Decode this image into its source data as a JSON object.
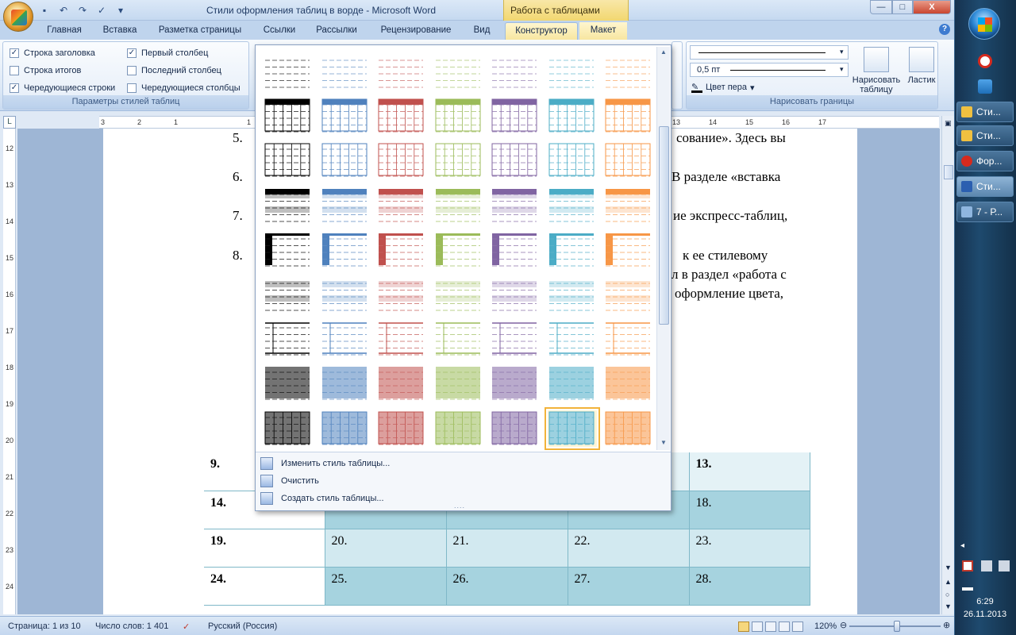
{
  "window": {
    "title": "Стили оформления таблиц в ворде - Microsoft Word",
    "context_tab_title": "Работа с таблицами",
    "controls": {
      "minimize": "—",
      "maximize": "□",
      "close": "X"
    }
  },
  "tabs": [
    {
      "label": "Главная"
    },
    {
      "label": "Вставка"
    },
    {
      "label": "Разметка страницы"
    },
    {
      "label": "Ссылки"
    },
    {
      "label": "Рассылки"
    },
    {
      "label": "Рецензирование"
    },
    {
      "label": "Вид"
    },
    {
      "label": "Конструктор",
      "active": true
    },
    {
      "label": "Макет"
    }
  ],
  "ribbon": {
    "style_options": {
      "group_label": "Параметры стилей таблиц",
      "options": [
        {
          "label": "Строка заголовка",
          "checked": true,
          "mark": "✓"
        },
        {
          "label": "Строка итогов",
          "checked": false,
          "mark": ""
        },
        {
          "label": "Чередующиеся строки",
          "checked": true,
          "mark": "✓"
        },
        {
          "label": "Первый столбец",
          "checked": true,
          "mark": "✓"
        },
        {
          "label": "Последний столбец",
          "checked": false,
          "mark": ""
        },
        {
          "label": "Чередующиеся столбцы",
          "checked": false,
          "mark": ""
        }
      ]
    },
    "draw_borders": {
      "group_label": "Нарисовать границы",
      "pen_weight": "0,5 пт",
      "pen_color_label": "Цвет пера",
      "draw_table_label": "Нарисовать таблицу",
      "eraser_label": "Ластик"
    }
  },
  "gallery": {
    "palette": [
      "#000000",
      "#4f81bd",
      "#c0504d",
      "#9bbb59",
      "#8064a2",
      "#4bacc6",
      "#f79646"
    ],
    "selected": {
      "row": 8,
      "col": 5
    },
    "menu": [
      {
        "label": "Изменить стиль таблицы..."
      },
      {
        "label": "Очистить"
      },
      {
        "label": "Создать стиль таблицы..."
      }
    ],
    "grip": "...."
  },
  "ruler": {
    "horizontal": [
      "3",
      "2",
      "1",
      "1",
      "2",
      "3",
      "13",
      "14",
      "15",
      "16",
      "17"
    ],
    "vertical": [
      "12",
      "13",
      "14",
      "15",
      "16",
      "17",
      "18",
      "19",
      "20",
      "21",
      "22",
      "23",
      "24"
    ]
  },
  "document": {
    "list": [
      {
        "num": "5.",
        "text": "сование». Здесь вы"
      },
      {
        "num": "6.",
        "text": "В разделе «вставка"
      },
      {
        "num": "7.",
        "text": "ие экспресс-таблиц,"
      },
      {
        "num": "8.",
        "text": "к ее стилевому"
      }
    ],
    "continuation": [
      "л в раздел «работа с",
      "оформление цвета,"
    ],
    "table": [
      [
        "9.",
        "",
        "",
        "",
        "13."
      ],
      [
        "14.",
        "",
        "",
        "",
        "18."
      ],
      [
        "19.",
        "20.",
        "21.",
        "22.",
        "23."
      ],
      [
        "24.",
        "25.",
        "26.",
        "27.",
        "28."
      ]
    ]
  },
  "statusbar": {
    "page": "Страница: 1 из 10",
    "words": "Число слов: 1 401",
    "language": "Русский (Россия)",
    "zoom": "120%"
  },
  "taskbar": {
    "items": [
      {
        "label": "Сти...",
        "active": false
      },
      {
        "label": "Сти...",
        "active": false
      },
      {
        "label": "Фор...",
        "active": false
      },
      {
        "label": "Сти...",
        "active": true
      },
      {
        "label": "7 - Р...",
        "active": false
      }
    ],
    "time": "6:29",
    "date": "26.11.2013"
  }
}
